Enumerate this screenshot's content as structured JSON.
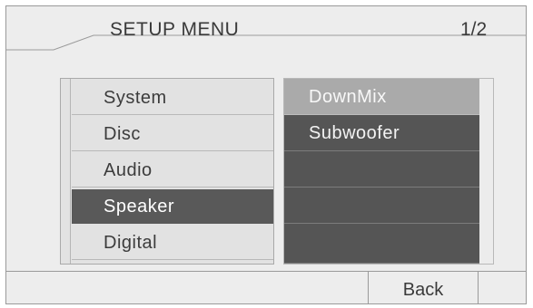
{
  "header": {
    "title": "SETUP MENU",
    "page_indicator": "1/2"
  },
  "main_menu": {
    "items": [
      {
        "label": "System",
        "selected": false
      },
      {
        "label": "Disc",
        "selected": false
      },
      {
        "label": "Audio",
        "selected": false
      },
      {
        "label": "Speaker",
        "selected": true
      },
      {
        "label": "Digital",
        "selected": false
      }
    ]
  },
  "sub_menu": {
    "items": [
      {
        "label": "DownMix",
        "highlighted": true
      },
      {
        "label": "Subwoofer",
        "highlighted": false
      },
      {
        "label": "",
        "highlighted": false
      },
      {
        "label": "",
        "highlighted": false
      },
      {
        "label": "",
        "highlighted": false
      }
    ]
  },
  "footer": {
    "back_label": "Back"
  },
  "colors": {
    "background": "#ededed",
    "selected": "#595959",
    "submenu": "#555555",
    "highlight": "#aaaaaa"
  }
}
